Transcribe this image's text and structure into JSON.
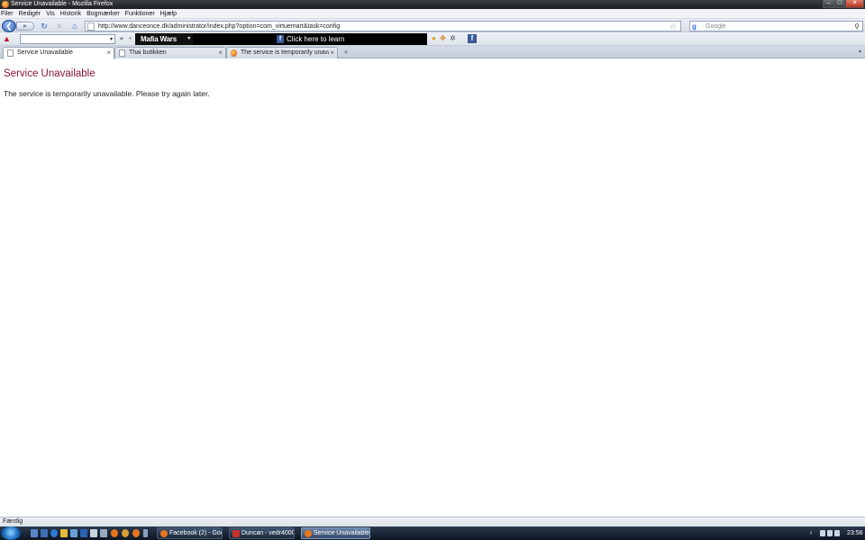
{
  "window": {
    "title": "Service Unavailable - Mozilla Firefox",
    "minimize_glyph": "–",
    "maximize_glyph": "□",
    "close_glyph": "✕"
  },
  "menu": [
    "Filer",
    "Redigér",
    "Vis",
    "Historik",
    "Bogmærker",
    "Funktioner",
    "Hjælp"
  ],
  "nav": {
    "back_glyph": "❮",
    "forward_glyph": "▸",
    "reload_glyph": "↻",
    "stop_glyph": "✕",
    "home_glyph": "⌂",
    "url": "http://www.danceonce.dk/administrator/index.php?option=com_virtuemart&task=config",
    "star_glyph": "☆",
    "search_engine_glyph": "g",
    "search_placeholder": "Google",
    "search_glyph": "⚲"
  },
  "toolbar": {
    "combo_value": "",
    "combo_arrow": "▾",
    "mafia_label": "Mafia Wars",
    "mafia_arrow": "▾",
    "fb_glyph": "f",
    "fb_text": "Click here to learn",
    "fb_icon_glyph": "f"
  },
  "tabs": [
    {
      "label": "Service Unavailable",
      "close": "×",
      "active": true
    },
    {
      "label": "Thai butikken",
      "close": "×",
      "active": false
    },
    {
      "label": "The service is temporarily unavailab...",
      "close": "×",
      "active": false
    }
  ],
  "newtab_glyph": "+",
  "tabscroll_glyph": "▾",
  "content": {
    "title": "Service Unavailable",
    "message": "The service is temporarily unavailable. Please try again later."
  },
  "status": "Færdig",
  "taskbar": {
    "tasks": [
      {
        "label": "Facebook (2) - Goo..."
      },
      {
        "label": "Duncan - vedr4000..."
      },
      {
        "label": "Service Unavailable ..."
      }
    ],
    "tray_arrow": "‹",
    "clock": "23:56"
  },
  "colors": {
    "error_title": "#8a1538",
    "facebook": "#3b5998"
  }
}
